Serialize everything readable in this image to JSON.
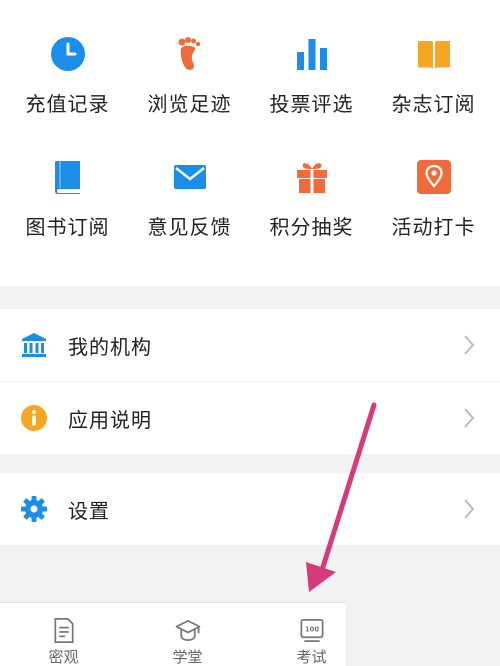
{
  "grid": {
    "items": [
      {
        "label": "充值记录",
        "icon": "clock-icon",
        "color": "#1a8ee8"
      },
      {
        "label": "浏览足迹",
        "icon": "footprint-icon",
        "color": "#f06a3a"
      },
      {
        "label": "投票评选",
        "icon": "bar-chart-icon",
        "color": "#1a8ee8"
      },
      {
        "label": "杂志订阅",
        "icon": "open-book-icon",
        "color": "#f5a623"
      },
      {
        "label": "图书订阅",
        "icon": "book-icon",
        "color": "#1a8ee8"
      },
      {
        "label": "意见反馈",
        "icon": "mail-icon",
        "color": "#1a8ee8"
      },
      {
        "label": "积分抽奖",
        "icon": "gift-icon",
        "color": "#f06a3a"
      },
      {
        "label": "活动打卡",
        "icon": "location-pin-icon",
        "color": "#f06a3a"
      }
    ]
  },
  "menu": {
    "items": [
      {
        "label": "我的机构",
        "icon": "institution-icon",
        "color": "#1a8ee8"
      },
      {
        "label": "应用说明",
        "icon": "info-icon",
        "color": "#f5a623"
      },
      {
        "label": "设置",
        "icon": "gear-icon",
        "color": "#1a8ee8"
      }
    ]
  },
  "tabbar": {
    "items": [
      {
        "label": "密观",
        "icon": "document-icon"
      },
      {
        "label": "学堂",
        "icon": "graduation-cap-icon"
      },
      {
        "label": "考试",
        "icon": "exam-score-icon"
      }
    ]
  },
  "annotation": {
    "color": "#d63a7a"
  }
}
